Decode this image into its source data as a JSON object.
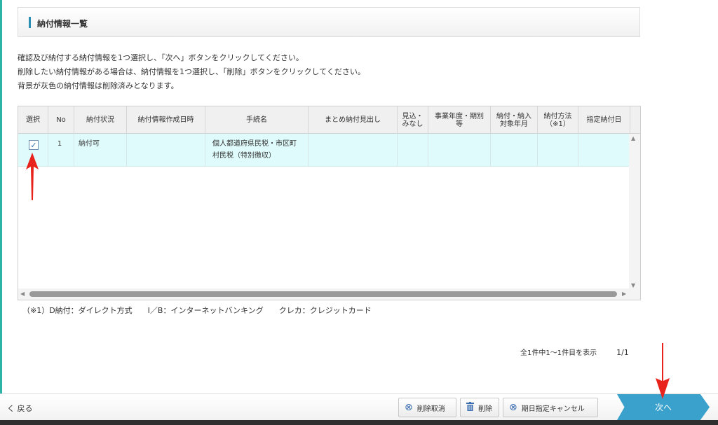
{
  "section": {
    "title": "納付情報一覧"
  },
  "instructions": [
    "確認及び納付する納付情報を1つ選択し、「次へ」ボタンをクリックしてください。",
    "削除したい納付情報がある場合は、納付情報を1つ選択し、「削除」ボタンをクリックしてください。",
    "背景が灰色の納付情報は削除済みとなります。"
  ],
  "table": {
    "columns": [
      "選択",
      "No",
      "納付状況",
      "納付情報作成日時",
      "手続名",
      "まとめ納付見出し",
      "見込・\nみなし",
      "事業年度・期別\n等",
      "納付・納入\n対象年月",
      "納付方法\n（※1）",
      "指定納付日"
    ],
    "rows": [
      {
        "no": "1",
        "status": "納付可",
        "created": "",
        "procedure_line1": "個人都道府県民税・市区町",
        "procedure_line2": "村民税（特別徴収）",
        "summary": "",
        "estimate": "",
        "fiscal": "",
        "target": "",
        "method": "",
        "date": "",
        "checked": "✓"
      }
    ]
  },
  "legend": "（※1）D納付：ダイレクト方式　　I／B：インターネットバンキング　　クレカ：クレジットカード",
  "pagination": {
    "summary": "全1件中1～1件目を表示",
    "page": "1/1"
  },
  "footer": {
    "back": "く 戻る",
    "undelete": "削除取消",
    "delete": "削除",
    "cancel_date": "期日指定キャンセル",
    "next": "次へ"
  },
  "colors": {
    "accent": "#3aa0cc",
    "row_selected": "#dffbfb",
    "annotation": "#e8231b"
  }
}
